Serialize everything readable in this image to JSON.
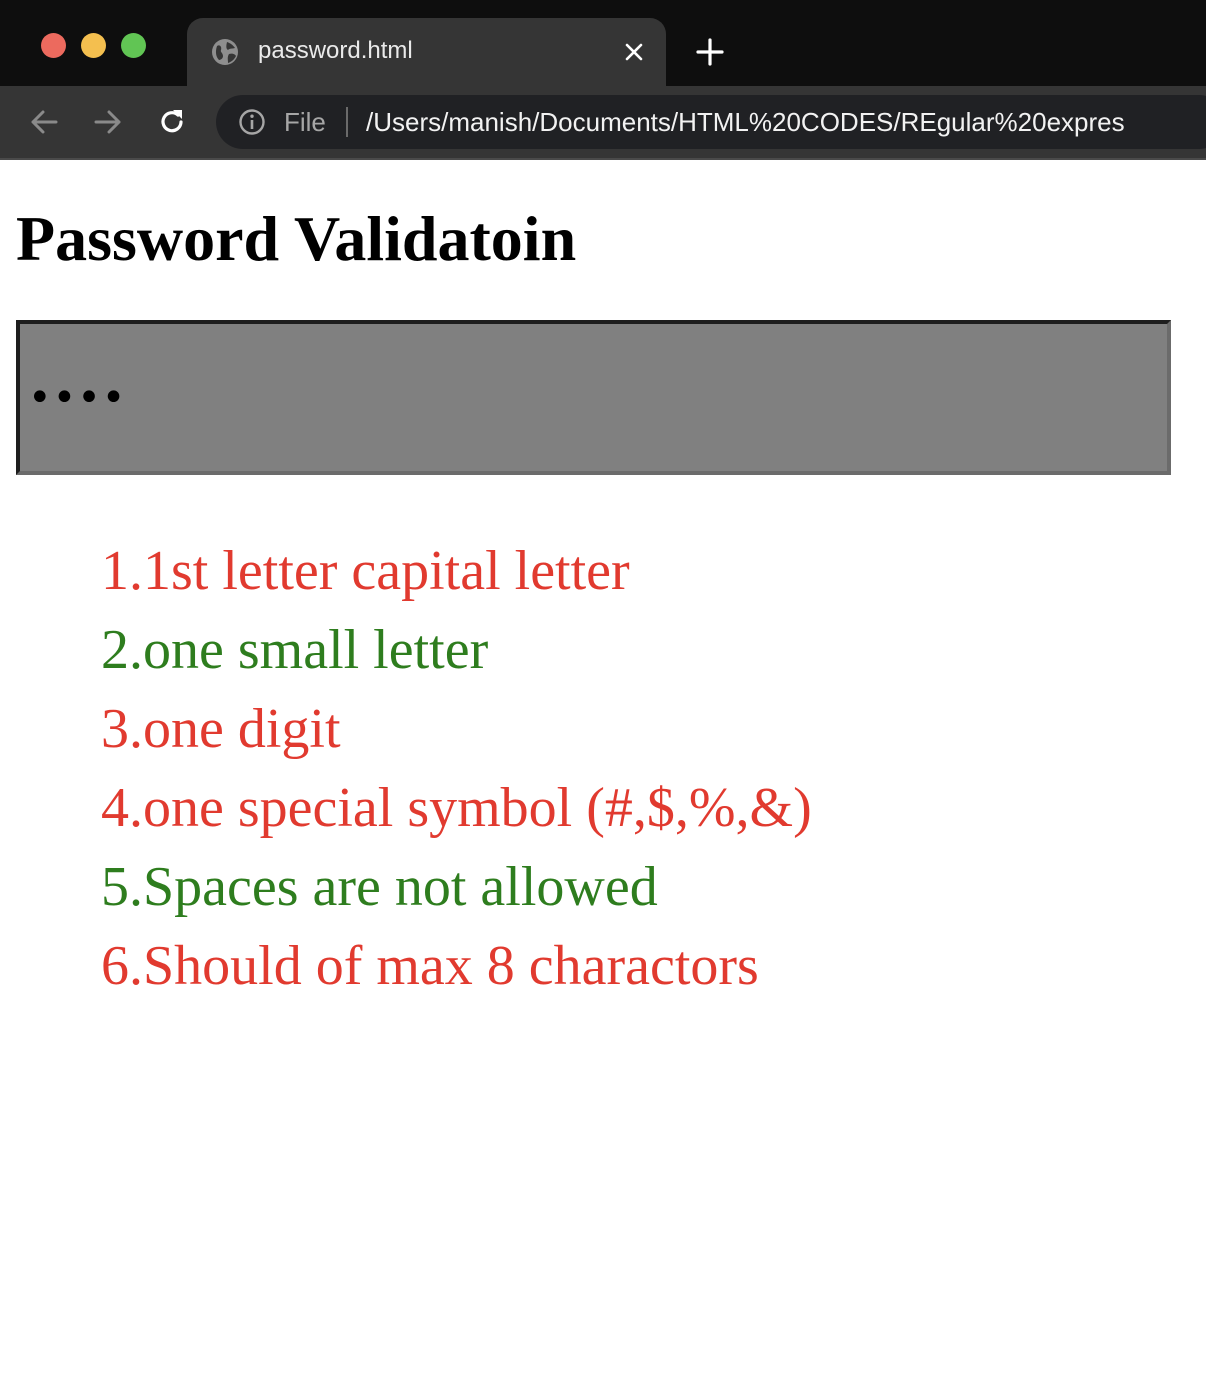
{
  "browser": {
    "tab_title": "password.html",
    "address_scheme": "File",
    "address_url": "/Users/manish/Documents/HTML%20CODES/REgular%20expres",
    "colors": {
      "close": "#ec6a5e",
      "minimize": "#f4bf4f",
      "zoom": "#61c554"
    }
  },
  "page": {
    "title": "Password Validatoin",
    "password": {
      "value": "••••"
    },
    "rules": [
      {
        "text": "1.1st letter capital letter",
        "status": "invalid",
        "color": "#e13a2f"
      },
      {
        "text": "2.one small letter",
        "status": "valid",
        "color": "#2e7d1e"
      },
      {
        "text": "3.one digit",
        "status": "invalid",
        "color": "#e13a2f"
      },
      {
        "text": "4.one special symbol (#,$,%,&)",
        "status": "invalid",
        "color": "#e13a2f"
      },
      {
        "text": "5.Spaces are not allowed",
        "status": "valid",
        "color": "#2e7d1e"
      },
      {
        "text": "6.Should of max 8 charactors",
        "status": "invalid",
        "color": "#e13a2f"
      }
    ]
  }
}
